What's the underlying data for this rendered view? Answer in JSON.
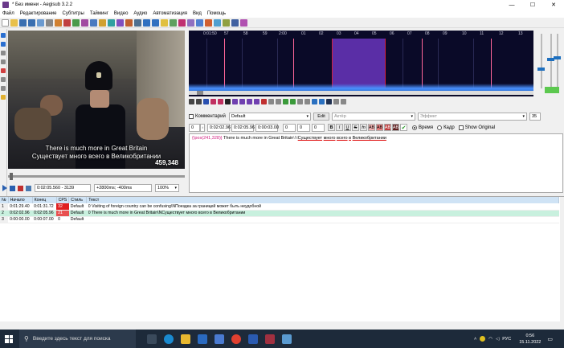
{
  "window": {
    "title": "* Без имени - Aegisub 3.2.2",
    "minimize_glyph": "—",
    "maximize_glyph": "☐",
    "close_glyph": "✕"
  },
  "menu": [
    "Файл",
    "Редактирование",
    "Субтитры",
    "Тайминг",
    "Видео",
    "Аудио",
    "Автоматизация",
    "Вид",
    "Помощь"
  ],
  "video": {
    "subtitle_line1": "There is much more in Great Britain",
    "subtitle_line2": "Существует много всего в Великобритании",
    "frame_counter": "459,348",
    "time_field": "0:02:05.560 - 3139",
    "offset_field": "+2800ms; -400ms",
    "zoom": "100%"
  },
  "audio": {
    "ruler_labels": [
      "0:01:50",
      "57",
      "58",
      "59",
      "2:00",
      "01",
      "02",
      "03",
      "04",
      "05",
      "06",
      "07",
      "08",
      "09",
      "10",
      "11",
      "12",
      "13"
    ],
    "accent_color": "#5a2ea6",
    "wave_color": "#4a90ff"
  },
  "edit": {
    "comment_label": "Комментарий",
    "style_value": "Default",
    "edit_button": "Edit",
    "actor_placeholder": "Актёр",
    "effect_placeholder": "Эффект",
    "margin_value": "35",
    "layer": "0",
    "start_time": "0:02:02.96",
    "end_time": "0:02:05.96",
    "duration": "0:00:03.00",
    "margin_l": "0",
    "margin_r": "0",
    "margin_v": "0",
    "fmt_bold": "B",
    "fmt_italic": "I",
    "fmt_underline": "U",
    "fmt_strike": "S",
    "fmt_font": "fn",
    "fmt_colors": [
      "AB",
      "AB",
      "AB",
      "AB"
    ],
    "time_radio": "Время",
    "frame_radio": "Кадр",
    "show_original": "Show Original",
    "text_override": "{\\pos(241,328)}",
    "text_main": " There is much more in Great Britain",
    "text_newline": "\\N",
    "text_word1": "Существует",
    "text_word2": "много",
    "text_word3": "всего",
    "text_word4": "в",
    "text_word5": "Великобритании"
  },
  "grid": {
    "headers": [
      "№",
      "Начало",
      "Конец",
      "CPS",
      "Стиль",
      "Текст"
    ],
    "rows": [
      {
        "num": "1",
        "start": "0:01:29.40",
        "end": "0:01:31.72",
        "cps": "32",
        "style": "Default",
        "text": "Visiting of foreign country can be confusing\\NПоездка за границей может быть неудобной"
      },
      {
        "num": "2",
        "start": "0:02:02.96",
        "end": "0:02:05.96",
        "cps": "21",
        "style": "Default",
        "text": "There is much more in Great Britain\\NСуществует много всего в Великобритании"
      },
      {
        "num": "3",
        "start": "0:00:00.00",
        "end": "0:00:07.00",
        "cps": "0",
        "style": "Default",
        "text": ""
      }
    ],
    "comment_mark": "0"
  },
  "taskbar": {
    "search_placeholder": "Введите здесь текст для поиска",
    "language": "РУС",
    "time": "0:56",
    "date": "15.11.2022"
  }
}
